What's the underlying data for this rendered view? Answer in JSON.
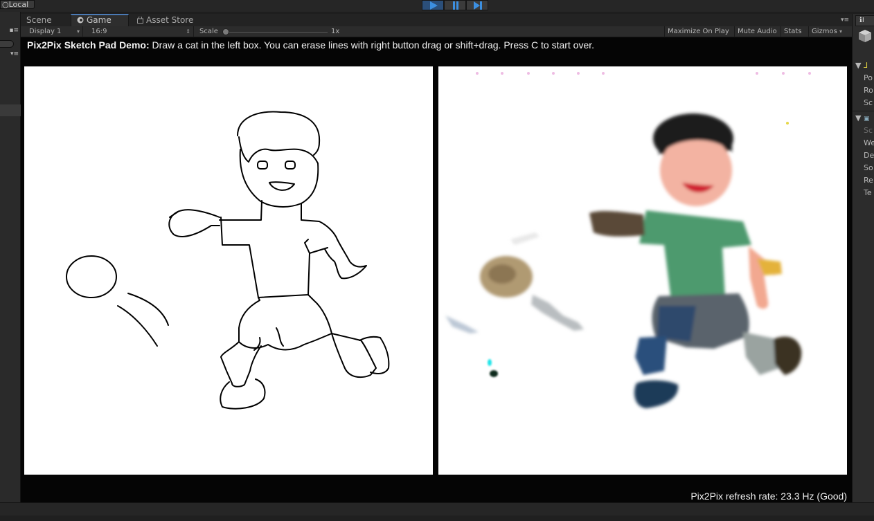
{
  "toolbar": {
    "local_label": "Local"
  },
  "tabs": [
    {
      "label": "Scene"
    },
    {
      "label": "Game"
    },
    {
      "label": "Asset Store"
    }
  ],
  "game_bar": {
    "display": "Display 1",
    "aspect": "16:9",
    "scale_label": "Scale",
    "scale_value": "1x",
    "maximize": "Maximize On Play",
    "mute": "Mute Audio",
    "stats": "Stats",
    "gizmos": "Gizmos"
  },
  "game": {
    "instruction_title": "Pix2Pix Sketch Pad Demo:",
    "instruction_text": " Draw a cat in the left box. You can erase lines with right button drag or shift+drag. Press C to start over.",
    "refresh_rate": "Pix2Pix refresh rate: 23.3 Hz (Good)"
  },
  "inspector": {
    "tab_label": "I",
    "rows": [
      "Po",
      "Ro",
      "Sc",
      "Sc",
      "We",
      "De",
      "So",
      "Re",
      "Te"
    ]
  },
  "colors": {
    "accent": "#2b4f7a",
    "panel_bg": "#ffffff",
    "view_bg": "#050505"
  }
}
